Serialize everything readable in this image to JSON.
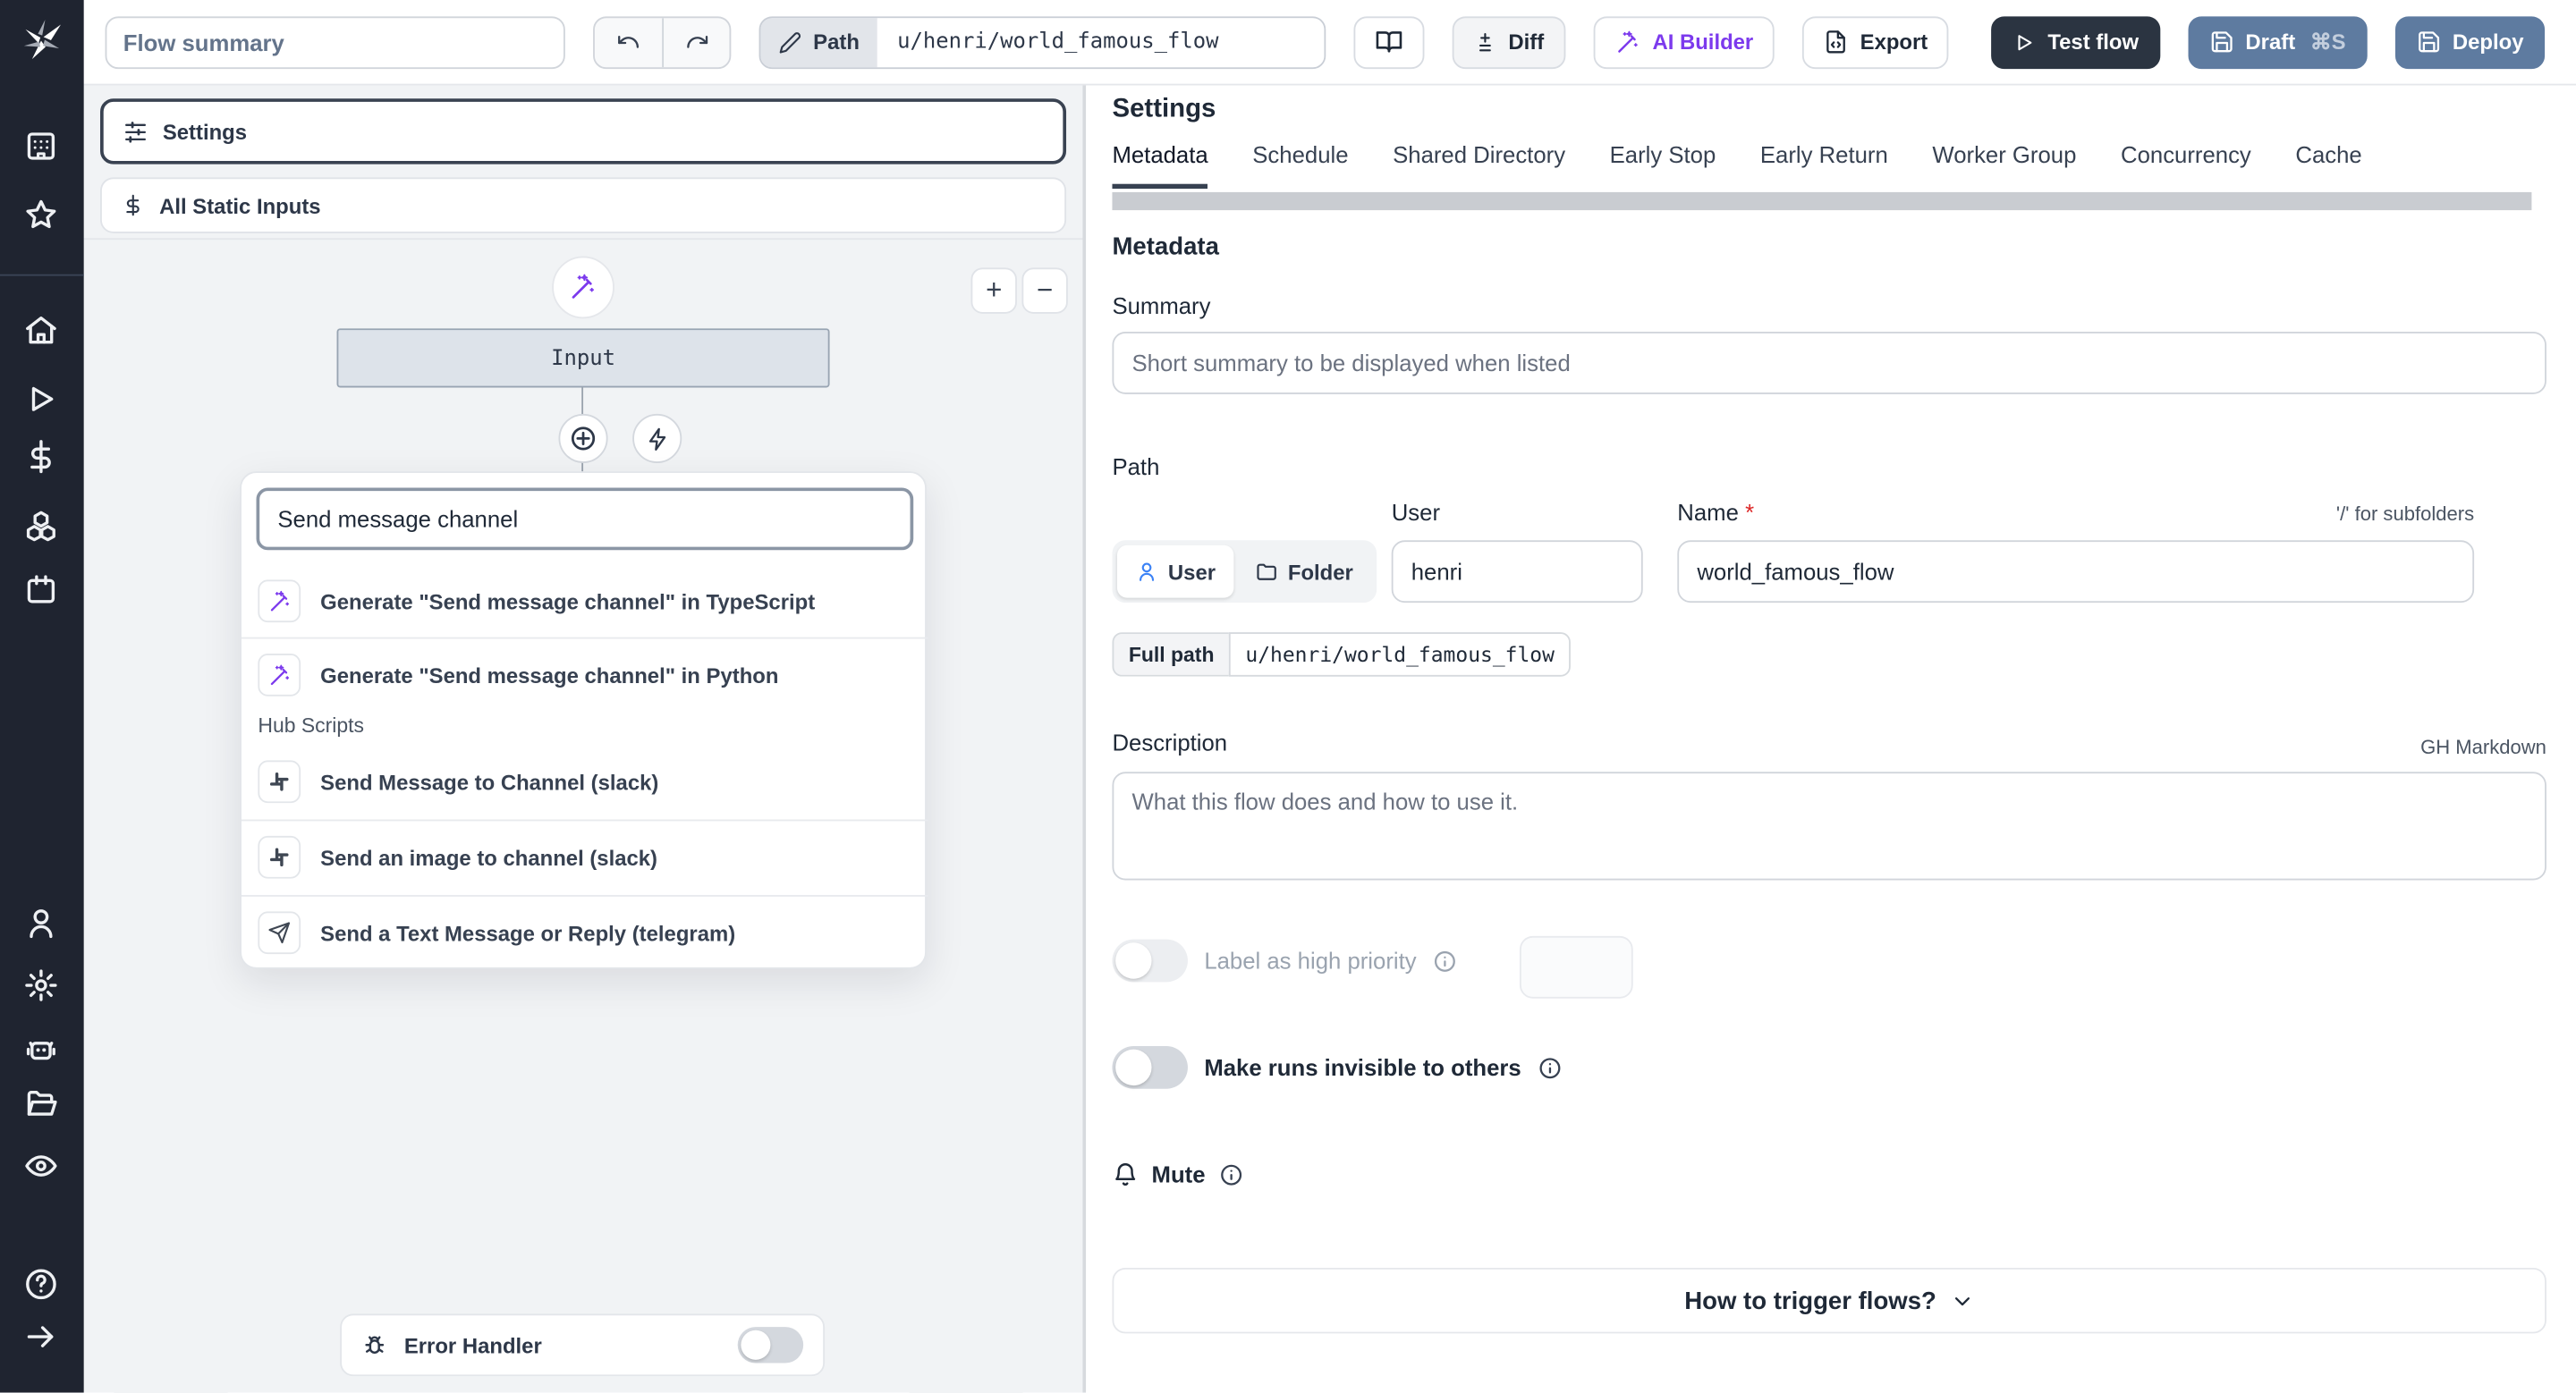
{
  "topbar": {
    "summary_placeholder": "Flow summary",
    "path_label": "Path",
    "path_value": "u/henri/world_famous_flow",
    "diff_label": "Diff",
    "ai_builder_label": "AI Builder",
    "export_label": "Export",
    "test_flow_label": "Test flow",
    "draft_label": "Draft",
    "draft_shortcut": "⌘S",
    "deploy_label": "Deploy"
  },
  "flow_editor": {
    "settings_card_label": "Settings",
    "static_inputs_label": "All Static Inputs",
    "input_node_label": "Input",
    "zoom_in": "+",
    "zoom_out": "−",
    "search_value": "Send message channel",
    "results": [
      {
        "icon": "wand-icon",
        "label": "Generate \"Send message channel\" in TypeScript"
      },
      {
        "icon": "wand-icon",
        "label": "Generate \"Send message channel\" in Python"
      }
    ],
    "hub_section_label": "Hub Scripts",
    "hub_results": [
      {
        "icon": "slack-icon",
        "label": "Send Message to Channel (slack)"
      },
      {
        "icon": "slack-icon",
        "label": "Send an image to channel (slack)"
      },
      {
        "icon": "telegram-icon",
        "label": "Send a Text Message or Reply (telegram)"
      }
    ],
    "error_handler_label": "Error Handler",
    "error_handler_enabled": false
  },
  "settings_panel": {
    "title": "Settings",
    "tabs": [
      "Metadata",
      "Schedule",
      "Shared Directory",
      "Early Stop",
      "Early Return",
      "Worker Group",
      "Concurrency",
      "Cache"
    ],
    "active_tab": "Metadata",
    "metadata": {
      "heading": "Metadata",
      "summary_label": "Summary",
      "summary_placeholder": "Short summary to be displayed when listed",
      "path_label": "Path",
      "owner_kind_user": "User",
      "owner_kind_folder": "Folder",
      "user_label": "User",
      "user_value": "henri",
      "name_label": "Name",
      "required_marker": "*",
      "subfolder_hint": "'/' for subfolders",
      "name_value": "world_famous_flow",
      "full_path_label": "Full path",
      "full_path_value": "u/henri/world_famous_flow",
      "description_label": "Description",
      "markdown_hint": "GH Markdown",
      "description_placeholder": "What this flow does and how to use it.",
      "high_priority_label": "Label as high priority",
      "high_priority_enabled": false,
      "invisible_runs_label": "Make runs invisible to others",
      "invisible_runs_enabled": false,
      "mute_label": "Mute",
      "trigger_accordion_label": "How to trigger flows?"
    }
  },
  "colors": {
    "sidebar_bg": "#1f2430",
    "canvas_bg": "#f1f3f5",
    "accent_purple": "#7c3aed",
    "primary_dark": "#2b3441",
    "deploy_blue": "#5e7ba0",
    "selected_border": "#394251",
    "link_blue": "#3b82f6",
    "required_red": "#dc2626"
  }
}
